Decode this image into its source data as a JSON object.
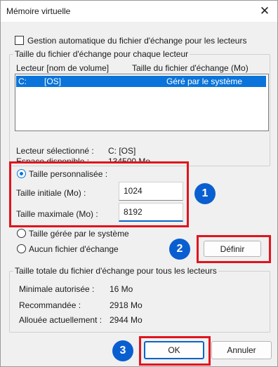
{
  "window": {
    "title": "Mémoire virtuelle"
  },
  "auto_manage": {
    "label": "Gestion automatique du fichier d'échange pour les lecteurs",
    "checked": false
  },
  "per_drive": {
    "group_title": "Taille du fichier d'échange pour chaque lecteur",
    "col_drive": "Lecteur [nom de volume]",
    "col_size": "Taille du fichier d'échange (Mo)",
    "rows": [
      {
        "drive": "C:",
        "volume": "[OS]",
        "size": "Géré par le système"
      }
    ],
    "selected_label": "Lecteur sélectionné :",
    "selected_value": "C:  [OS]",
    "space_label": "Espace disponible :",
    "space_value": "134500 Mo"
  },
  "options": {
    "custom": "Taille personnalisée :",
    "initial_label": "Taille initiale (Mo) :",
    "initial_value": "1024",
    "max_label": "Taille maximale (Mo) :",
    "max_value": "8192",
    "system_managed": "Taille gérée par le système",
    "none": "Aucun fichier d'échange",
    "selected": "custom",
    "set_button": "Définir"
  },
  "totals": {
    "group_title": "Taille totale du fichier d'échange pour tous les lecteurs",
    "min_label": "Minimale autorisée :",
    "min_value": "16 Mo",
    "recommended_label": "Recommandée :",
    "recommended_value": "2918 Mo",
    "allocated_label": "Allouée actuellement :",
    "allocated_value": "2944 Mo"
  },
  "buttons": {
    "ok": "OK",
    "cancel": "Annuler"
  },
  "annotations": {
    "step1": "1",
    "step2": "2",
    "step3": "3",
    "highlight_color": "#e0141e",
    "badge_color": "#0a5fd0"
  }
}
